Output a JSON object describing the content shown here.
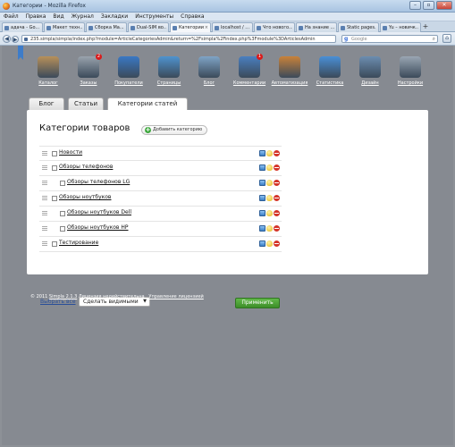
{
  "window": {
    "title": "Категории - Mozilla Firefox",
    "buttons": [
      "–",
      "▫",
      "✕"
    ]
  },
  "menubar": [
    "Файл",
    "Правка",
    "Вид",
    "Журнал",
    "Закладки",
    "Инструменты",
    "Справка"
  ],
  "browser_tabs": [
    {
      "label": "адача - Go...",
      "active": false
    },
    {
      "label": "Макет техн...",
      "active": false
    },
    {
      "label": "Сборка Ма...",
      "active": false
    },
    {
      "label": "Dual-SIM во...",
      "active": false
    },
    {
      "label": "Категории",
      "active": true
    },
    {
      "label": "localhost / ...",
      "active": false
    },
    {
      "label": "Что нового...",
      "active": false
    },
    {
      "label": "На знание ...",
      "active": false
    },
    {
      "label": "Static pages...",
      "active": false
    },
    {
      "label": "Yu – новичк...",
      "active": false
    }
  ],
  "navbar": {
    "url": "235.simpla/simpla/index.php?module=ArticleCategoriesAdmin&return=%2Fsimpla%2Findex.php%3Fmodule%3DArticlesAdmin",
    "search_placeholder": "Google",
    "search_engine_icon": "g-icon"
  },
  "admin_menu": [
    {
      "label": "Каталог",
      "icon": "catalog-icon",
      "color": "#b8905a",
      "badge": ""
    },
    {
      "label": "Заказы",
      "icon": "orders-icon",
      "color": "#9aa3ad",
      "badge": "2"
    },
    {
      "label": "Покупатели",
      "icon": "users-icon",
      "color": "#3a78c4",
      "badge": ""
    },
    {
      "label": "Страницы",
      "icon": "pages-icon",
      "color": "#4f93cf",
      "badge": ""
    },
    {
      "label": "Блог",
      "icon": "blog-icon",
      "color": "#7fa4c6",
      "badge": ""
    },
    {
      "label": "Комментарии",
      "icon": "comments-icon",
      "color": "#4a7fc0",
      "badge": "1"
    },
    {
      "label": "Автоматизация",
      "icon": "wand-icon",
      "color": "#c9823a",
      "badge": ""
    },
    {
      "label": "Статистика",
      "icon": "stats-icon",
      "color": "#4a8fd6",
      "badge": ""
    },
    {
      "label": "Дизайн",
      "icon": "design-icon",
      "color": "#6c8db0",
      "badge": ""
    },
    {
      "label": "Настройки",
      "icon": "settings-icon",
      "color": "#9aa6b3",
      "badge": ""
    }
  ],
  "page_tabs": [
    {
      "label": "Блог",
      "active": false
    },
    {
      "label": "Статьи",
      "active": false
    },
    {
      "label": "Категории статей",
      "active": true
    }
  ],
  "main": {
    "title": "Категории товаров",
    "add_button": "Добавить категорию",
    "select_all": "Выбрать все",
    "action_select": "Сделать видимыми",
    "apply_button": "Применить"
  },
  "categories": [
    {
      "name": "Новости",
      "level": 0
    },
    {
      "name": "Обзоры телефонов",
      "level": 0
    },
    {
      "name": "Обзоры телефонов LG",
      "level": 1
    },
    {
      "name": "Обзоры ноутбуков",
      "level": 0
    },
    {
      "name": "Обзоры ноутбуков Dell",
      "level": 1
    },
    {
      "name": "Обзоры ноутбуков HP",
      "level": 1
    },
    {
      "name": "Тестирование",
      "level": 0
    }
  ],
  "footer": {
    "copyright": "© 2011",
    "product": "Simpla 2.1.3",
    "license": "Лицензия недействительна",
    "manage": "Управление лицензией"
  }
}
